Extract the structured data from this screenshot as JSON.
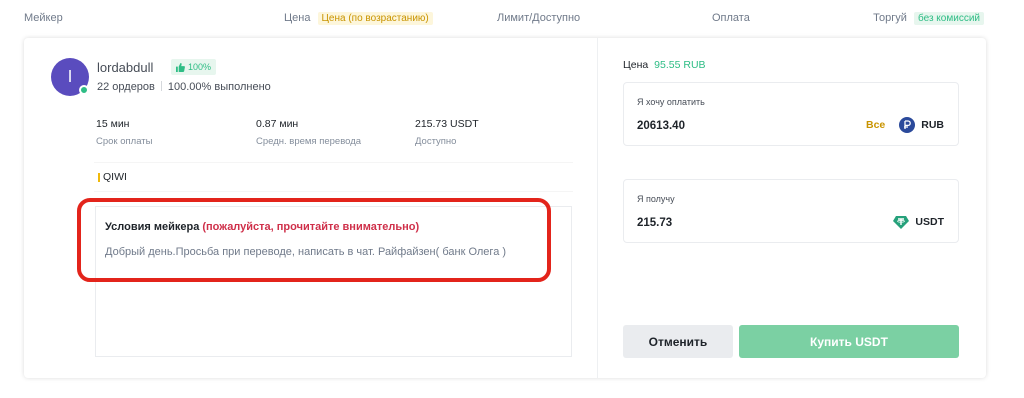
{
  "header": {
    "maker": "Мейкер",
    "price": "Цена",
    "price_sort": "Цена (по возрастанию)",
    "limit": "Лимит/Доступно",
    "payment": "Оплата",
    "trade": "Торгуй",
    "trade_badge": "без комиссий"
  },
  "maker": {
    "avatar_letter": "l",
    "name": "lordabdull",
    "rating": "100%",
    "orders": "22 ордеров",
    "completion": "100.00% выполнено"
  },
  "stats": [
    {
      "value": "15 мин",
      "label": "Срок оплаты"
    },
    {
      "value": "0.87 мин",
      "label": "Средн. время перевода"
    },
    {
      "value": "215.73 USDT",
      "label": "Доступно"
    }
  ],
  "payment_method": "QIWI",
  "terms": {
    "title": "Условия мейкера",
    "warning": "(пожалуйста, прочитайте внимательно)",
    "text": "Добрый день.Просьба при переводе, написать в чат. Райфайзен( банк Олега )"
  },
  "price": {
    "label": "Цена",
    "value": "95.55 RUB"
  },
  "pay_box": {
    "label": "Я хочу оплатить",
    "value": "20613.40",
    "all": "Все",
    "currency": "RUB",
    "icon": "rub-coin-icon"
  },
  "get_box": {
    "label": "Я получу",
    "value": "215.73",
    "currency": "USDT",
    "icon": "usdt-coin-icon"
  },
  "buttons": {
    "cancel": "Отменить",
    "buy": "Купить USDT"
  },
  "colors": {
    "green": "#2ebd85",
    "buy_button": "#7bd0a3",
    "warning": "#cf304a",
    "highlight": "#e3241b",
    "yellow": "#c99400"
  }
}
